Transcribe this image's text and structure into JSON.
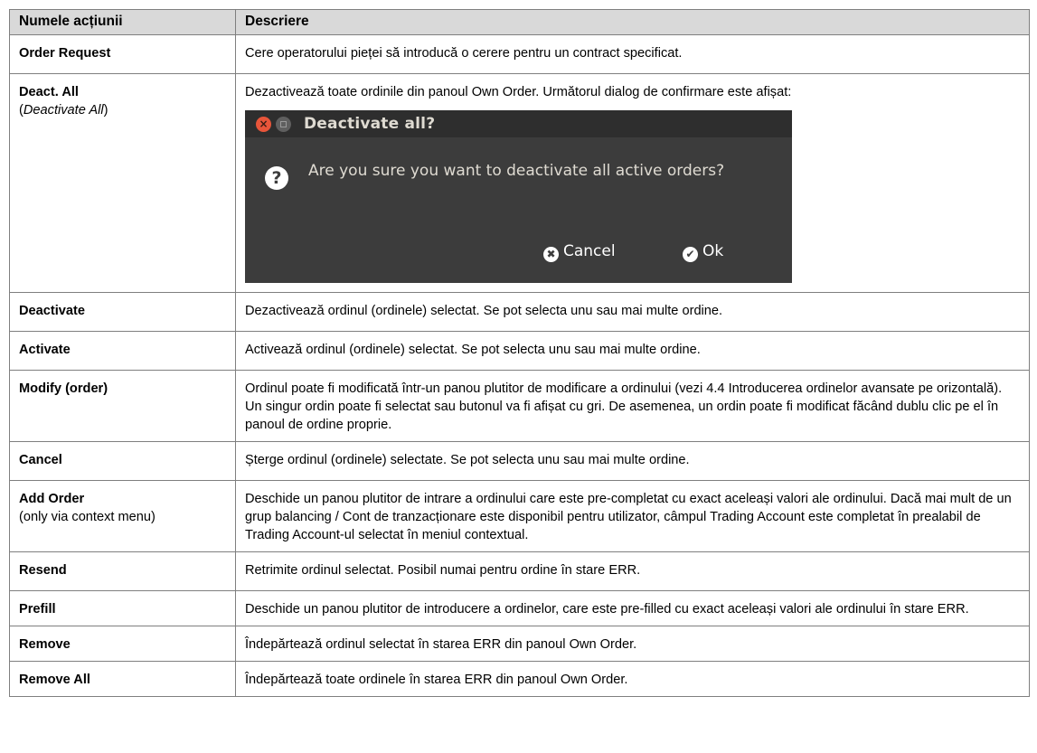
{
  "table": {
    "header": {
      "col1": "Numele acțiunii",
      "col2": "Descriere"
    },
    "rows": [
      {
        "name": "Order Request",
        "desc": "Cere operatorului pieței să introducă o cerere pentru un contract specificat."
      },
      {
        "name": "Deact. All",
        "sub_open": "(",
        "sub_italic": "Deactivate All",
        "sub_close": ")",
        "desc": "Dezactivează toate ordinile din panoul Own Order. Următorul dialog de confirmare este afișat:"
      },
      {
        "name": "Deactivate",
        "desc": "Dezactivează ordinul (ordinele) selectat. Se pot selecta unu sau mai multe ordine."
      },
      {
        "name": "Activate",
        "desc": "Activează ordinul (ordinele) selectat. Se pot selecta unu sau mai multe ordine."
      },
      {
        "name": "Modify (order)",
        "desc": "Ordinul poate fi modificată într-un panou plutitor de modificare a ordinului (vezi 4.4 Introducerea ordinelor avansate pe orizontală). Un singur ordin poate fi selectat sau butonul va fi afișat cu gri. De asemenea, un ordin poate fi modificat făcând dublu clic pe el în panoul de ordine proprie."
      },
      {
        "name": "Cancel",
        "desc": "Șterge ordinul (ordinele) selectate. Se pot selecta unu sau mai multe ordine."
      },
      {
        "name": "Add Order",
        "sub": "(only via context menu)",
        "desc": "Deschide un panou plutitor de intrare a ordinului care este pre-completat cu exact aceleași valori ale ordinului. Dacă mai mult de un  grup balancing / Cont de tranzacționare este disponibil pentru utilizator, câmpul Trading Account este completat în prealabil de Trading Account-ul selectat în meniul contextual."
      },
      {
        "name": "Resend",
        "desc": "Retrimite ordinul selectat. Posibil numai pentru ordine în stare ERR."
      },
      {
        "name": "Prefill",
        "desc": "Deschide un panou plutitor de introducere a ordinelor, care este pre-filled cu exact aceleași valori ale ordinului în stare ERR."
      },
      {
        "name": "Remove",
        "desc": "Îndepărtează ordinul selectat în starea ERR din panoul Own Order."
      },
      {
        "name": "Remove All",
        "desc": "Îndepărtează toate ordinele în starea ERR din panoul Own Order."
      }
    ]
  },
  "dialog": {
    "title": "Deactivate all?",
    "message": "Are you sure you want to deactivate all active orders?",
    "cancel_label": "Cancel",
    "ok_label": "Ok",
    "close_glyph": "×",
    "question_glyph": "?",
    "cancel_glyph": "✖",
    "ok_glyph": "✔",
    "icons": {
      "close": "close-icon",
      "minimize": "minimize-icon",
      "question": "question-icon",
      "cancel": "cancel-icon",
      "ok": "check-icon"
    },
    "colors": {
      "background": "#3c3c3c",
      "close_button": "#e8553a",
      "text": "#dfdbd2"
    }
  }
}
